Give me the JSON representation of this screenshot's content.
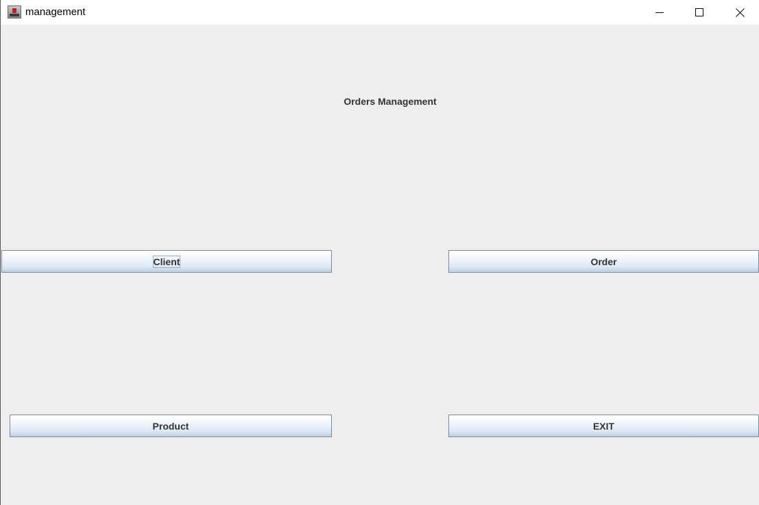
{
  "window": {
    "title": "management",
    "icon": "java-app-icon",
    "controls": [
      "minimize-icon",
      "maximize-icon",
      "close-icon"
    ]
  },
  "main": {
    "heading": "Orders Management",
    "buttons": {
      "client": "Client",
      "order": "Order",
      "product": "Product",
      "exit": "EXIT"
    },
    "focused_button": "client"
  },
  "colors": {
    "background": "#eeeeee",
    "button_border": "#7a8a99",
    "button_gradient_bottom": "#b8cfe5",
    "text": "#333333"
  }
}
